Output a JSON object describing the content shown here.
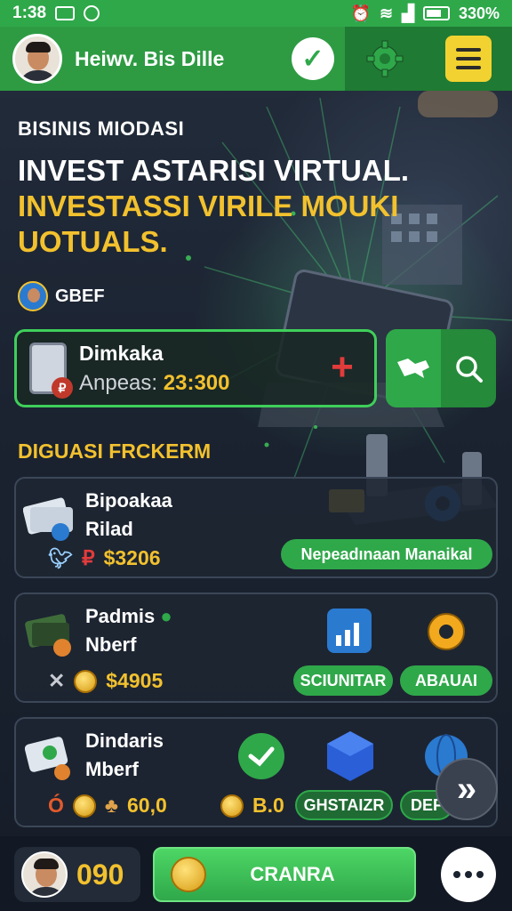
{
  "status_bar": {
    "time": "1:38",
    "battery": "330%"
  },
  "header": {
    "username": "Heiwv. Bis Dille"
  },
  "hero": {
    "section_label": "BISINIS MIODASI",
    "title_line1": "INVEST ASTARISI  VIRTUAL.",
    "title_line2": "INVESTASSI VIRILE MOUKI",
    "title_line3": "UOTUALS.",
    "author": "GBEF"
  },
  "account": {
    "name": "Dimkaka",
    "balance_label": "Anpeas:",
    "balance_value": "23:300"
  },
  "list": {
    "title": "DIGUASI FRCKERM",
    "items": [
      {
        "name": "Bipoakaa",
        "sub": "Rilad",
        "amount": "$3206",
        "action": "Nepeadınaan Manaikal"
      },
      {
        "name": "Padmis",
        "sub": "Nberf",
        "amount": "$4905",
        "actions": [
          "SCIUNITAR",
          "ABAUAI"
        ]
      },
      {
        "name": "Dindaris",
        "sub": "Mberf",
        "amount": "60,0",
        "amount2": "B.0",
        "actions": [
          "GHSTAIZR",
          "DEF"
        ]
      }
    ]
  },
  "bottom": {
    "score": "090",
    "primary_label": "CRANRA"
  },
  "colors": {
    "accent_green": "#2fa84a",
    "gold": "#f2c12e",
    "menu_yellow": "#f2d230"
  }
}
